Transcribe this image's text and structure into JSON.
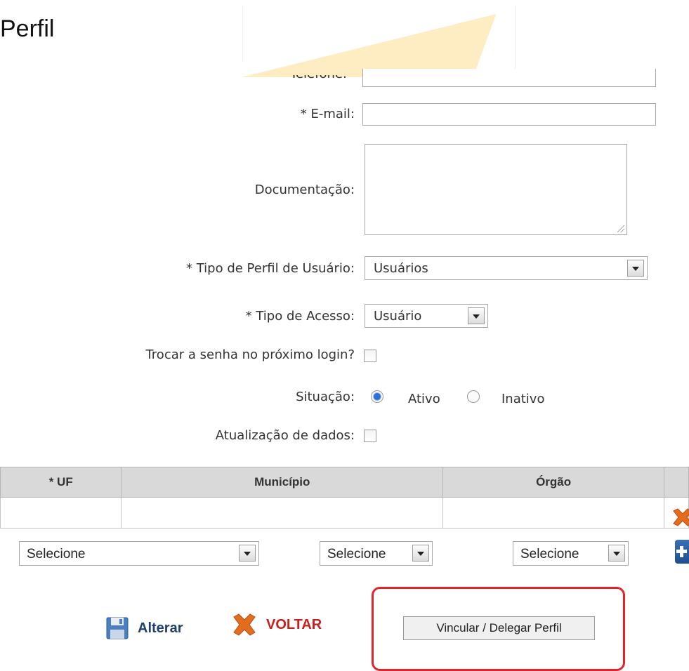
{
  "page_title": "Perfil",
  "form": {
    "telefone_label": "Telefone:",
    "email_label": "* E-mail:",
    "email_value": "",
    "documentacao_label": "Documentação:",
    "tipo_perfil_label": "* Tipo de Perfil de Usuário:",
    "tipo_perfil_value": "Usuários",
    "tipo_acesso_label": "* Tipo de Acesso:",
    "tipo_acesso_value": "Usuário",
    "trocar_senha_label": "Trocar a senha no próximo login?",
    "trocar_senha_checked": false,
    "situacao_label": "Situação:",
    "situacao_options": [
      "Ativo",
      "Inativo"
    ],
    "situacao_selected": "Ativo",
    "atualizacao_label": "Atualização de dados:",
    "atualizacao_checked": false
  },
  "table": {
    "headers": [
      "* UF",
      "Município",
      "Órgão"
    ],
    "rows": [
      [
        "",
        "",
        ""
      ]
    ]
  },
  "selectors": {
    "uf_value": "Selecione",
    "municipio_value": "Selecione",
    "orgao_value": "Selecione"
  },
  "actions": {
    "alterar_label": "Alterar",
    "voltar_label": "VOLTAR",
    "vincular_label": "Vincular / Delegar Perfil"
  },
  "icons": {
    "delete_row": "x-icon",
    "add_row": "plus-icon",
    "save": "floppy-icon",
    "back": "x-icon"
  },
  "colors": {
    "highlight": "#e0262b",
    "voltar_text": "#c8201c",
    "alterar_text": "#1f3f6e",
    "plus_button": "#2a5ba0",
    "delete_icon": "#e46c1d"
  }
}
